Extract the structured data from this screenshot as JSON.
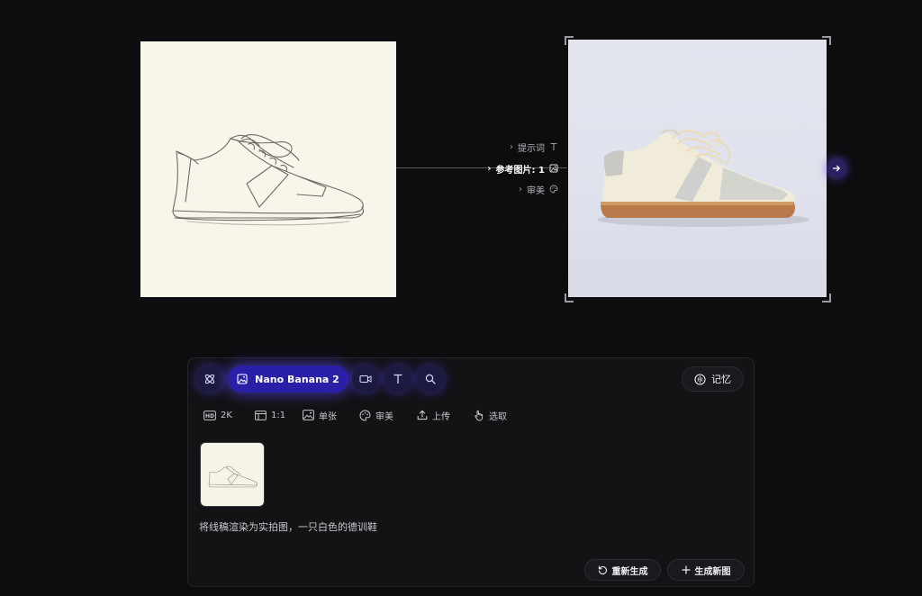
{
  "canvas": {
    "params": [
      {
        "label": "提示词",
        "icon": "text-icon",
        "active": false
      },
      {
        "label": "参考图片: 1",
        "icon": "image-icon",
        "active": true
      },
      {
        "label": "审美",
        "icon": "palette-icon",
        "active": false
      }
    ]
  },
  "toolbar": {
    "model_label": "Nano Banana 2",
    "memory_label": "记忆"
  },
  "options": [
    {
      "label": "2K",
      "icon": "hd-icon"
    },
    {
      "label": "1:1",
      "icon": "aspect-ratio-icon"
    },
    {
      "label": "单张",
      "icon": "image-icon"
    },
    {
      "label": "审美",
      "icon": "palette-icon"
    },
    {
      "label": "上传",
      "icon": "upload-icon"
    },
    {
      "label": "选取",
      "icon": "pointer-icon"
    }
  ],
  "prompt": {
    "text": "将线稿渲染为实拍图，一只白色的德训鞋"
  },
  "actions": {
    "regenerate_label": "重新生成",
    "new_label": "生成新图"
  },
  "colors": {
    "background": "#0d0c0e",
    "accent": "#2a20a8",
    "accent_glow": "#5a46ff",
    "panel": "#131215"
  }
}
